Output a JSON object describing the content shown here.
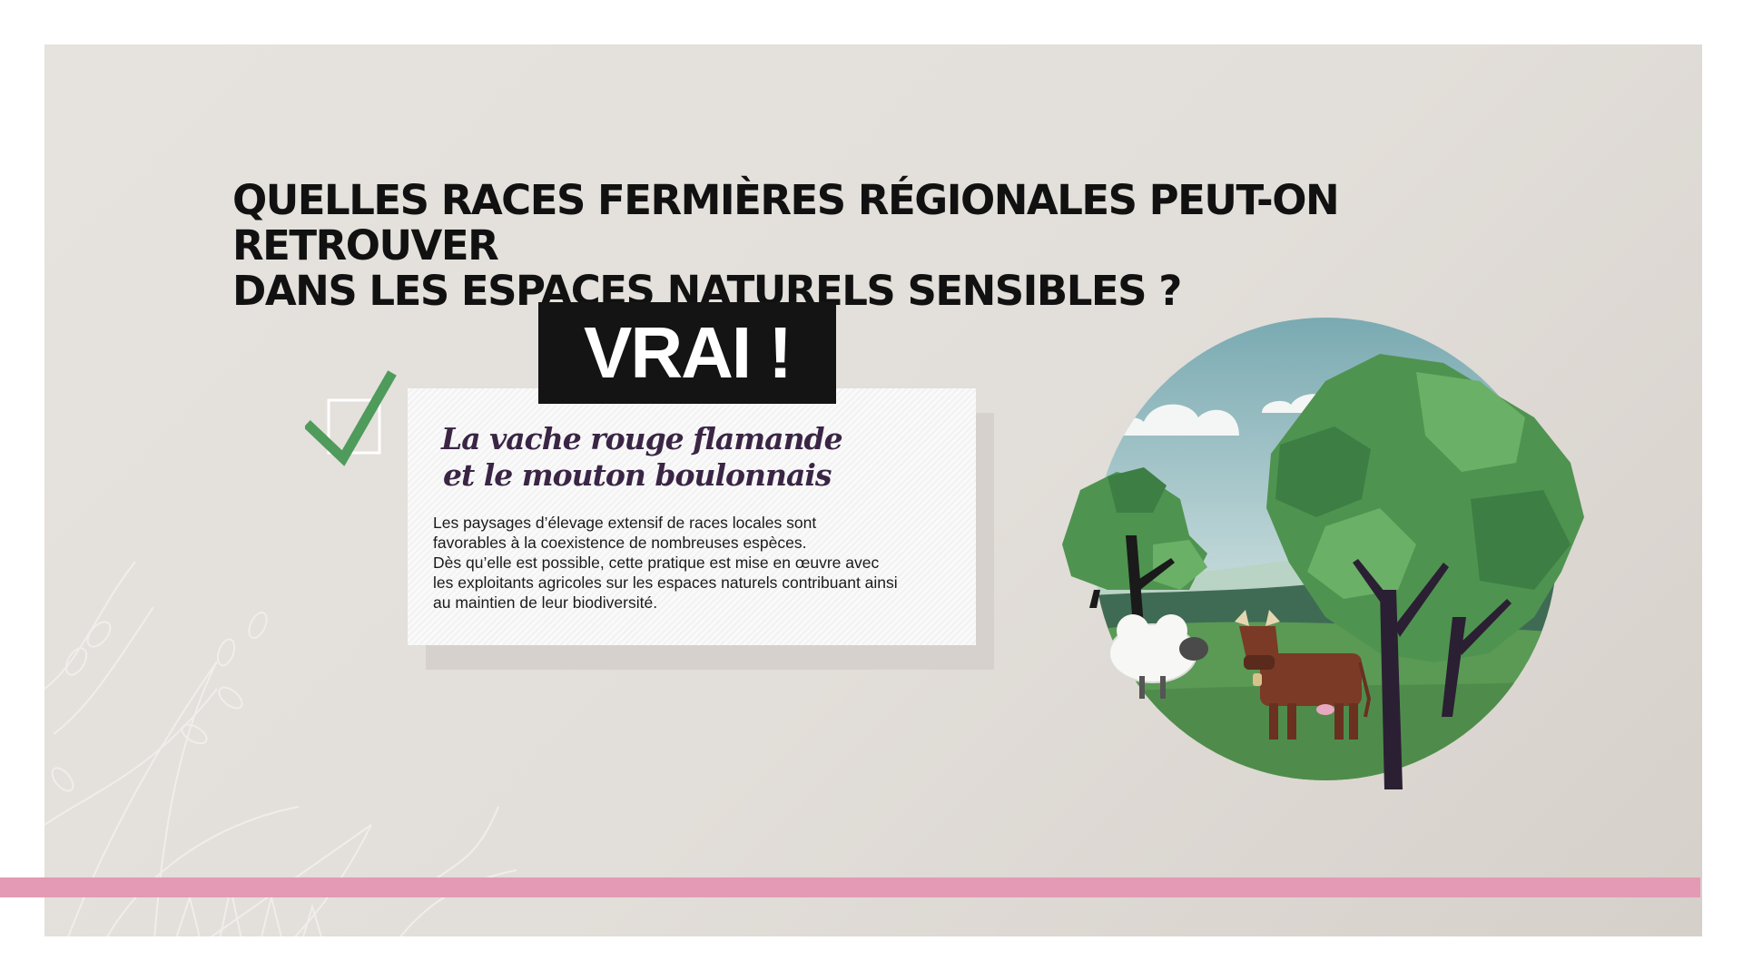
{
  "question": {
    "line1": "QUELLES RACES FERMIÈRES RÉGIONALES PEUT-ON RETROUVER",
    "line2": "DANS LES ESPACES NATURELS SENSIBLES ?"
  },
  "verdict": "VRAI !",
  "card": {
    "title_line1": "La vache rouge flamande",
    "title_line2": "et le mouton boulonnais",
    "body_lines": [
      "Les paysages d’élevage extensif de races locales sont",
      "favorables à la coexistence de nombreuses espèces.",
      "Dès qu’elle est possible, cette pratique est mise en œuvre avec",
      "les exploitants agricoles sur les espaces naturels contribuant ainsi",
      "au maintien de leur biodiversité."
    ]
  },
  "icons": {
    "check": "checkmark-icon",
    "illustration": "pasture-scene-illustration",
    "decor": "leaf-pattern-decoration"
  },
  "colors": {
    "accent_bar": "#e49ab5",
    "check_green": "#4e9b5c",
    "verdict_bg": "#141414",
    "title_purple": "#3a2545"
  }
}
